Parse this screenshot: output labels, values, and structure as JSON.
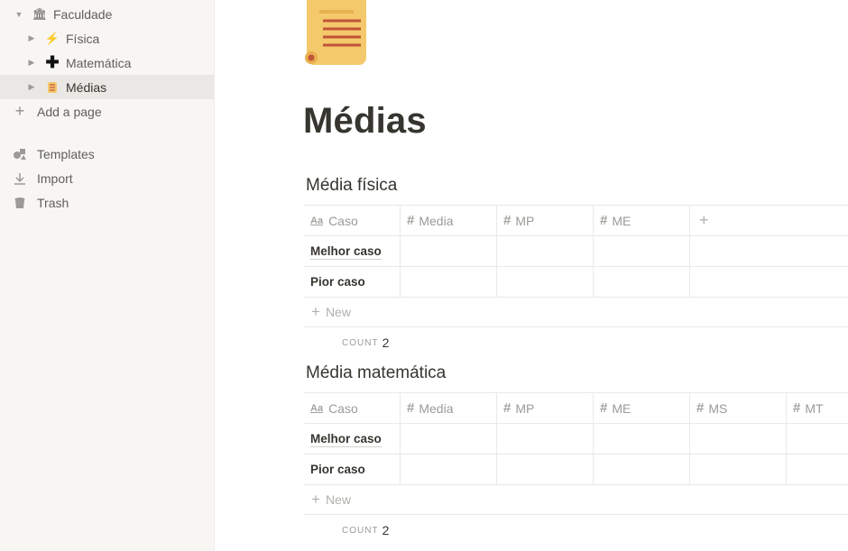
{
  "sidebar": {
    "items": [
      {
        "label": "Faculdade",
        "icon": "bank-icon"
      },
      {
        "label": "Física",
        "icon": "lightning-icon"
      },
      {
        "label": "Matemática",
        "icon": "plus-icon"
      },
      {
        "label": "Médias",
        "icon": "scroll-icon"
      }
    ],
    "add_page": "Add a page",
    "utilities": [
      {
        "label": "Templates",
        "icon": "templates-icon"
      },
      {
        "label": "Import",
        "icon": "download-icon"
      },
      {
        "label": "Trash",
        "icon": "trash-icon"
      }
    ]
  },
  "page": {
    "icon": "scroll-icon",
    "title": "Médias"
  },
  "databases": [
    {
      "title": "Média física",
      "columns": [
        "Caso",
        "Media",
        "MP",
        "ME"
      ],
      "rows": [
        "Melhor caso",
        "Pior caso"
      ],
      "new_label": "New",
      "count_label": "COUNT",
      "count_value": "2"
    },
    {
      "title": "Média matemática",
      "columns": [
        "Caso",
        "Media",
        "MP",
        "ME",
        "MS",
        "MT"
      ],
      "rows": [
        "Melhor caso",
        "Pior caso"
      ],
      "new_label": "New",
      "count_label": "COUNT",
      "count_value": "2"
    }
  ],
  "colors": {
    "sidebar_bg": "#f7f6f3",
    "active_row": "#e9e8e4",
    "text": "#37352f",
    "muted": "#9b9a97"
  }
}
